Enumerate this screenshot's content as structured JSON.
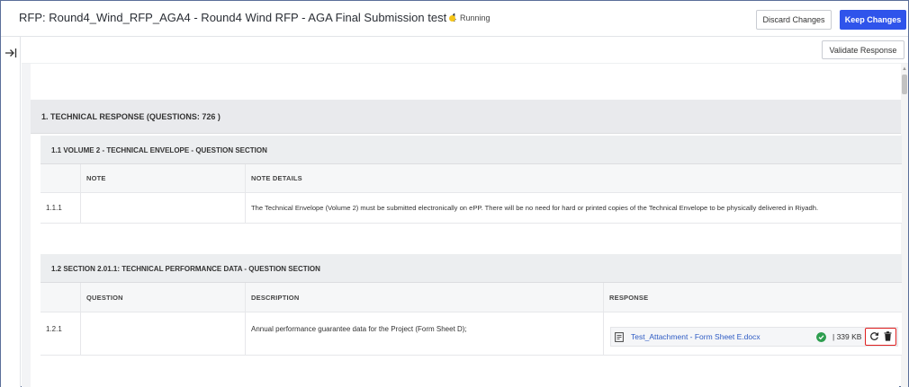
{
  "header": {
    "title": "RFP: Round4_Wind_RFP_AGA4 - Round4 Wind RFP - AGA Final Submission test 4",
    "status": "Running",
    "discard_label": "Discard Changes",
    "keep_label": "Keep Changes"
  },
  "toolbar": {
    "validate_label": "Validate Response"
  },
  "sections": [
    {
      "title": "1. TECHNICAL RESPONSE (QUESTIONS: 726 )",
      "subsections": [
        {
          "title": "1.1  VOLUME 2 - TECHNICAL ENVELOPE - QUESTION SECTION",
          "columns": [
            "NOTE",
            "NOTE DETAILS"
          ],
          "rows": [
            {
              "id": "1.1.1",
              "note": "",
              "details": "The Technical Envelope (Volume 2) must be submitted electronically on ePP. There will be no need for hard or printed copies of the Technical Envelope to be physically delivered in Riyadh."
            }
          ]
        },
        {
          "title": "1.2  SECTION 2.01.1: TECHNICAL PERFORMANCE DATA - QUESTION SECTION",
          "columns": [
            "QUESTION",
            "DESCRIPTION",
            "RESPONSE"
          ],
          "rows": [
            {
              "id": "1.2.1",
              "question": "",
              "description": "Annual performance guarantee data for the Project (Form Sheet D);",
              "response": {
                "file_name": "Test_Attachment - Form Sheet E.docx",
                "file_size": "| 339 KB",
                "icons": [
                  "document-icon",
                  "check-circle-icon",
                  "replace-icon",
                  "trash-icon"
                ]
              }
            }
          ]
        }
      ]
    }
  ],
  "colors": {
    "accent": "#2f54eb",
    "status_running": "#f5c518",
    "success": "#2e9e4f",
    "highlight": "#e02020",
    "link": "#2e5bc4"
  }
}
